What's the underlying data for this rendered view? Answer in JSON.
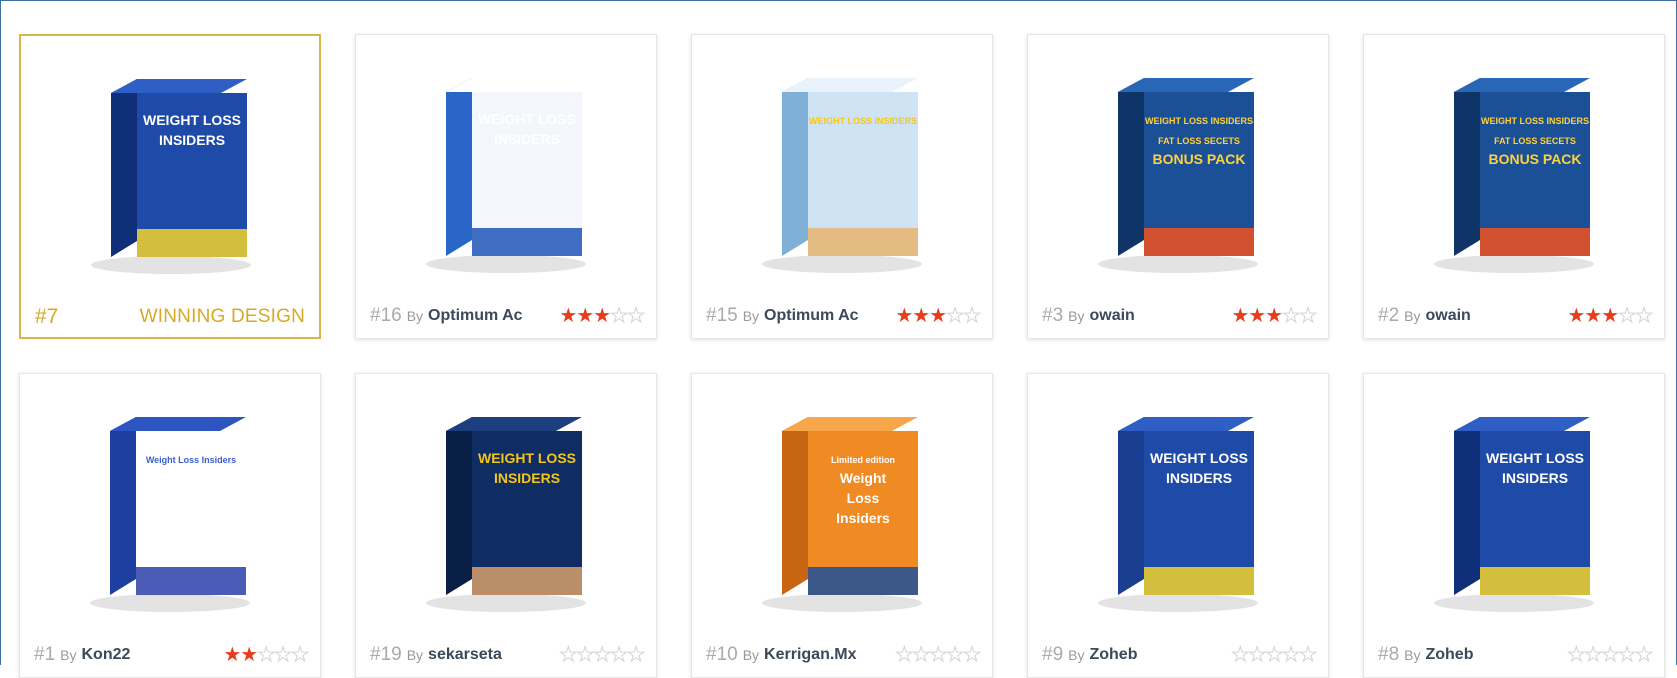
{
  "cards": [
    {
      "rank": "#7",
      "winner_label": "WINNING DESIGN",
      "winner": true,
      "box": {
        "front": "#1e4aa8",
        "side": "#0f2f78",
        "top": "#2f5ec4",
        "title": [
          "WEIGHT LOSS",
          "INSIDERS"
        ],
        "title_color": "#ffffff",
        "accent": "#f5d22b"
      }
    },
    {
      "rank": "#16",
      "by": "By",
      "author": "Optimum Ac",
      "rating": 3,
      "box": {
        "front": "#f3f6fb",
        "side": "#2a66c7",
        "top": "#ffffff",
        "title": [
          "WEIGHT LOSS",
          "INSIDERS"
        ],
        "title_color": "#ffffff",
        "accent": "#1f55b8"
      }
    },
    {
      "rank": "#15",
      "by": "By",
      "author": "Optimum Ac",
      "rating": 3,
      "box": {
        "front": "#cfe3f4",
        "side": "#7fb0d8",
        "top": "#e9f3fb",
        "title": [
          "WEIGHT LOSS INSIDERS"
        ],
        "title_color": "#f2c81e",
        "accent": "#e7b56f"
      }
    },
    {
      "rank": "#3",
      "by": "By",
      "author": "owain",
      "rating": 3,
      "box": {
        "front": "#1b4f96",
        "side": "#0e3468",
        "top": "#2a66b8",
        "title": [
          "WEIGHT LOSS INSIDERS",
          "FAT LOSS SECETS",
          "BONUS PACK"
        ],
        "title_color": "#ffd23a",
        "accent": "#f0521e"
      }
    },
    {
      "rank": "#2",
      "by": "By",
      "author": "owain",
      "rating": 3,
      "box": {
        "front": "#1b4f96",
        "side": "#0e3468",
        "top": "#2a66b8",
        "title": [
          "WEIGHT LOSS INSIDERS",
          "FAT LOSS SECETS",
          "BONUS PACK"
        ],
        "title_color": "#ffd23a",
        "accent": "#f0521e"
      }
    },
    {
      "rank": "#1",
      "by": "By",
      "author": "Kon22",
      "rating": 2,
      "box": {
        "front": "#ffffff",
        "side": "#1c3fa0",
        "top": "#2d55c2",
        "title": [
          "Weight Loss Insiders"
        ],
        "title_color": "#3b5fd1",
        "accent": "#2a3fa8"
      }
    },
    {
      "rank": "#19",
      "by": "By",
      "author": "sekarseta",
      "rating": 0,
      "box": {
        "front": "#0f2d63",
        "side": "#0a1f46",
        "top": "#1d3f80",
        "title": [
          "WEIGHT LOSS",
          "INSIDERS"
        ],
        "title_color": "#f5c518",
        "accent": "#d9a06b"
      }
    },
    {
      "rank": "#10",
      "by": "By",
      "author": "Kerrigan.Mx",
      "rating": 0,
      "box": {
        "front": "#f08a22",
        "side": "#c86512",
        "top": "#f7a64a",
        "title": [
          "Limited edition",
          "Weight",
          "Loss",
          "Insiders"
        ],
        "title_color": "#ffffff",
        "accent": "#1c4f9a"
      }
    },
    {
      "rank": "#9",
      "by": "By",
      "author": "Zoheb",
      "rating": 0,
      "box": {
        "front": "#1e4aa8",
        "side": "#1a3f90",
        "top": "#2f5ec4",
        "title": [
          "WEIGHT LOSS",
          "INSIDERS"
        ],
        "title_color": "#ffffff",
        "accent": "#f5d22b"
      }
    },
    {
      "rank": "#8",
      "by": "By",
      "author": "Zoheb",
      "rating": 0,
      "box": {
        "front": "#1e4aa8",
        "side": "#0f2f78",
        "top": "#2f5ec4",
        "title": [
          "WEIGHT LOSS",
          "INSIDERS"
        ],
        "title_color": "#ffffff",
        "accent": "#f5d22b"
      }
    }
  ],
  "max_rating": 5
}
